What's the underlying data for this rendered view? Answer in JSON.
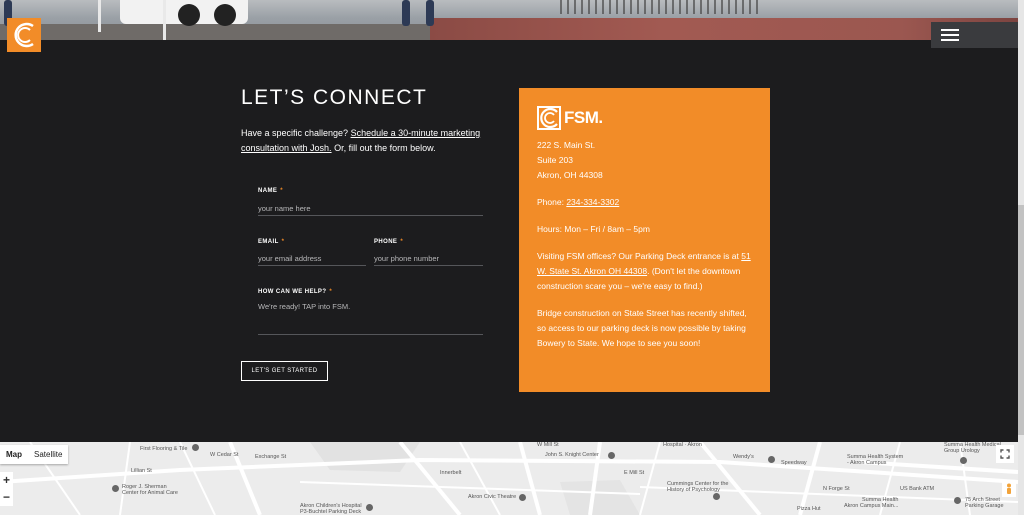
{
  "header": {
    "logo_icon": "fsm-logo-icon",
    "menu_icon": "hamburger-menu-icon"
  },
  "connect": {
    "title": "LET’S CONNECT",
    "intro_prefix": "Have a specific challenge? ",
    "intro_link": "Schedule a 30-minute marketing consultation with Josh.",
    "intro_suffix": " Or, fill out the form below."
  },
  "form": {
    "name_label": "NAME",
    "name_placeholder": "your name here",
    "email_label": "EMAIL",
    "email_placeholder": "your email address",
    "phone_label": "PHONE",
    "phone_placeholder": "your phone number",
    "help_label": "HOW CAN WE HELP?",
    "help_placeholder": "We're ready! TAP into FSM.",
    "required_mark": "*",
    "submit_label": "LET'S GET STARTED"
  },
  "card": {
    "brand": "FSM.",
    "address_line1": "222 S. Main St.",
    "address_line2": "Suite 203",
    "address_line3": "Akron, OH 44308",
    "phone_prefix": "Phone: ",
    "phone": "234-334-3302",
    "hours": "Hours: Mon – Fri / 8am – 5pm",
    "parking_prefix": "Visiting FSM offices? Our Parking Deck entrance is at ",
    "parking_link": "51 W. State St. Akron OH 44308",
    "parking_suffix": ". (Don't let the downtown construction scare you – we're easy to find.)",
    "bridge_note": "Bridge construction on State Street has recently shifted, so access to our parking deck is now possible by taking Bowery to State. We hope to see you soon!",
    "accent_color": "#f28c28"
  },
  "map": {
    "type_map": "Map",
    "type_satellite": "Satellite",
    "zoom_in": "+",
    "zoom_out": "−",
    "labels": {
      "first_flooring": "First Flooring & Tile",
      "roger_sherman": "Roger J. Sherman",
      "roger_sherman_2": "Center for Animal Care",
      "john_knight": "John S. Knight Center",
      "hospital_akron": "Hospital · Akron",
      "wendys": "Wendy's",
      "speedway": "Speedway",
      "summa_system": "Summa Health System",
      "summa_system_2": "- Akron Campus",
      "summa_medical": "Summa Health Medical",
      "summa_medical_2": "Group Urology",
      "akron_civic": "Akron Civic Theatre",
      "cummings": "Cummings Center for the",
      "cummings_2": "History of Psychology",
      "akron_childrens": "Akron Children's Hospital",
      "akron_childrens_2": "P3-Buchtel Parking Deck",
      "us_bank": "US Bank ATM",
      "summa_campus": "Summa Health",
      "summa_campus_2": "Akron Campus Main...",
      "arch_street": "75 Arch Street",
      "arch_street_2": "Parking Garage",
      "pizza_hut": "Pizza Hut",
      "interbelt": "Innerbelt",
      "w_exchange": "Exchange St",
      "e_mill": "E Mill St",
      "w_mill": "W Mill St",
      "n_forge": "N Forge St",
      "lilian": "Lillian St",
      "w_cedar": "W Cedar St"
    },
    "fullscreen_icon": "fullscreen-icon",
    "pegman_icon": "pegman-icon"
  }
}
